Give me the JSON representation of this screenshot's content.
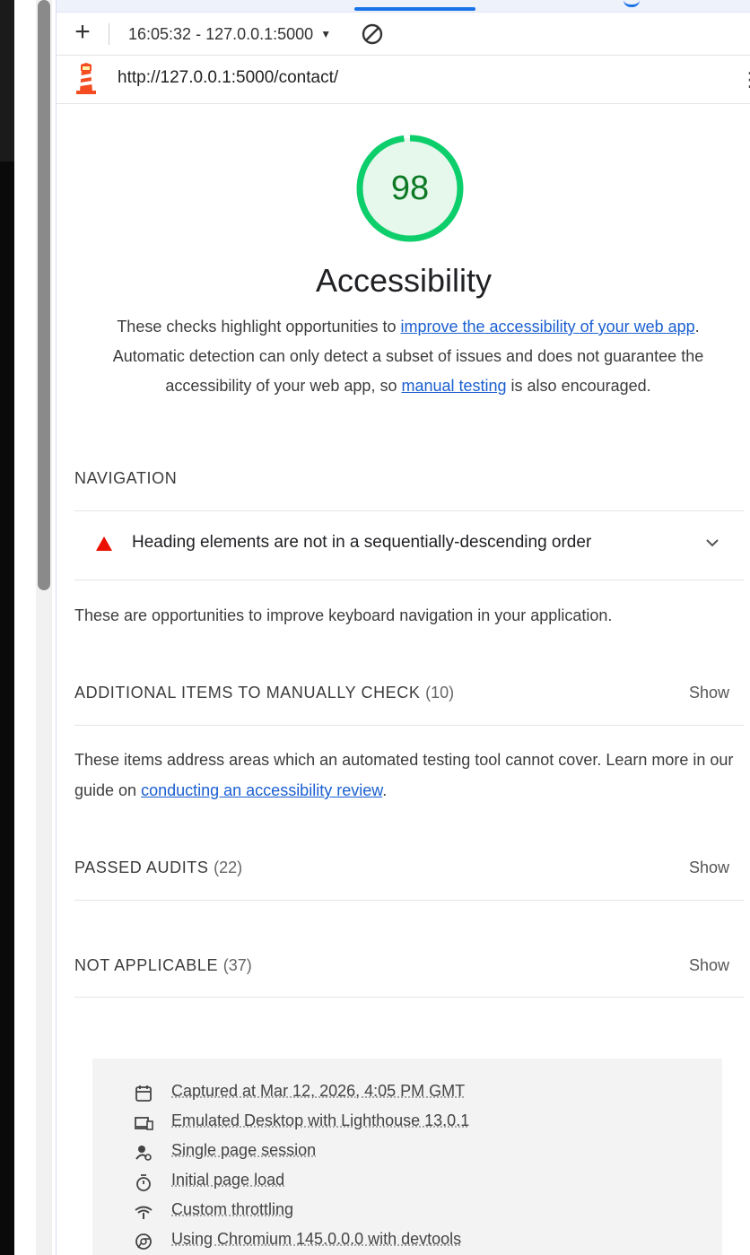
{
  "toolbar": {
    "add_label": "+",
    "report_label": "16:05:32 - 127.0.0.1:5000",
    "clear_icon": "block-icon"
  },
  "urlbar": {
    "url": "http://127.0.0.1:5000/contact/",
    "menu_label": "⋮"
  },
  "category": {
    "score": "98",
    "score_fraction": 0.98,
    "score_color": "#0cce6b",
    "title": "Accessibility",
    "desc_before": "These checks highlight opportunities to ",
    "link1": "improve the accessibility of your web app",
    "desc_middle": ". Automatic detection can only detect a subset of issues and does not guarantee the accessibility of your web app, so ",
    "link2": "manual testing",
    "desc_after": " is also encouraged."
  },
  "navigation": {
    "heading": "NAVIGATION",
    "audit_title": "Heading elements are not in a sequentially-descending order",
    "note": "These are opportunities to improve keyboard navigation in your application."
  },
  "manual": {
    "heading": "ADDITIONAL ITEMS TO MANUALLY CHECK",
    "count": "(10)",
    "show": "Show",
    "note_before": "These items address areas which an automated testing tool cannot cover. Learn more in our guide on ",
    "note_link": "conducting an accessibility review",
    "note_after": "."
  },
  "passed": {
    "heading": "PASSED AUDITS",
    "count": "(22)",
    "show": "Show"
  },
  "not_applicable": {
    "heading": "NOT APPLICABLE",
    "count": "(37)",
    "show": "Show"
  },
  "environment": [
    {
      "icon": "calendar-icon",
      "label": "Captured at Mar 12, 2026, 4:05 PM GMT"
    },
    {
      "icon": "desktop-icon",
      "label": "Emulated Desktop with Lighthouse 13.0.1"
    },
    {
      "icon": "session-icon",
      "label": "Single page session"
    },
    {
      "icon": "stopwatch-icon",
      "label": "Initial page load"
    },
    {
      "icon": "network-icon",
      "label": "Custom throttling"
    },
    {
      "icon": "chromium-icon",
      "label": "Using Chromium 145.0.0.0 with devtools"
    }
  ],
  "colors": {
    "pass_green": "#0cce6b",
    "fail_red": "#eb0f00",
    "link_blue": "#1a5fd0",
    "accent_blue": "#1a73e8"
  }
}
